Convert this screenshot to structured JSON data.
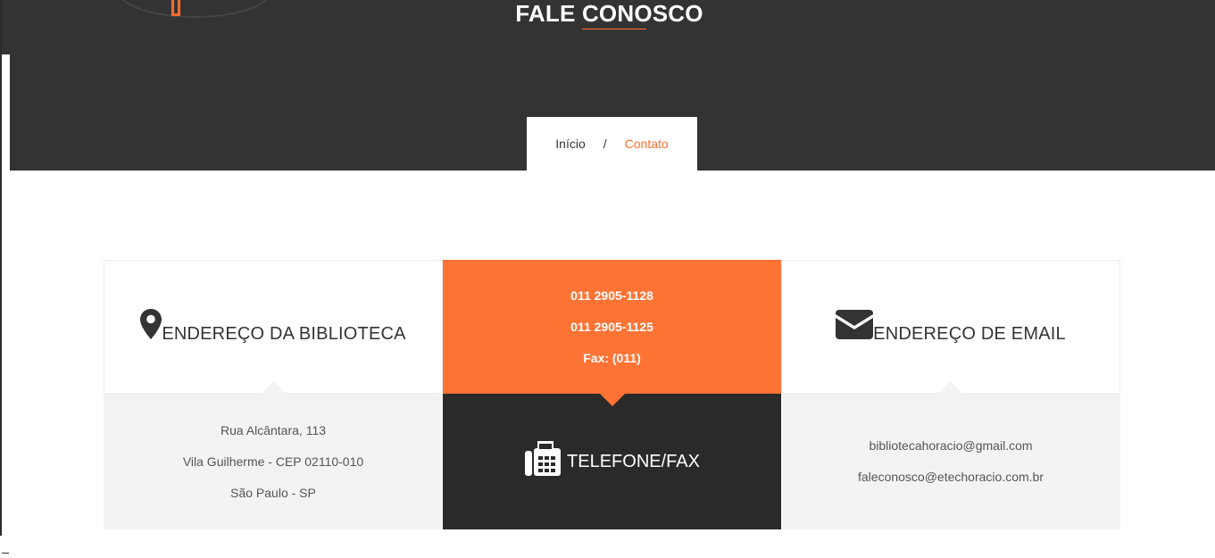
{
  "header": {
    "title": "FALE CONOSCO"
  },
  "breadcrumb": {
    "home": "Início",
    "separator": "/",
    "current": "Contato"
  },
  "cards": {
    "address": {
      "icon": "map-marker-icon",
      "heading": "ENDEREÇO DA BIBLIOTECA",
      "lines": [
        "Rua Alcântara, 113",
        "Vila Guilherme - CEP 02110-010",
        "São Paulo - SP"
      ]
    },
    "phone": {
      "icon": "fax-icon",
      "heading": "TELEFONE/FAX",
      "lines": [
        "011 2905-1128",
        "011 2905-1125",
        "Fax: (011)"
      ]
    },
    "email": {
      "icon": "envelope-icon",
      "heading": "ENDEREÇO DE EMAIL",
      "lines": [
        "bibliotecahoracio@gmail.com",
        "faleconosco@etechoracio.com.br"
      ]
    }
  },
  "colors": {
    "accent": "#ff7335",
    "dark": "#333333",
    "panel": "#f3f3f3"
  }
}
